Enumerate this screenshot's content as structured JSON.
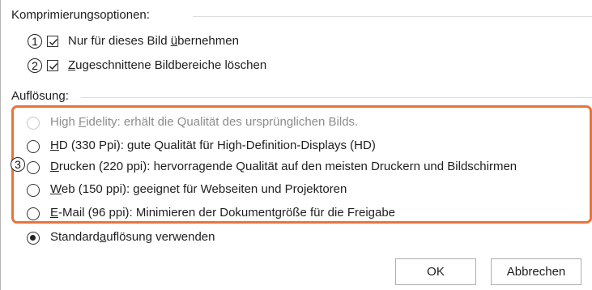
{
  "compression": {
    "title": "Komprimierungsoptionen:",
    "options": [
      {
        "callout": "1",
        "checked": true,
        "pre": "Nur für dieses Bild ",
        "accel": "ü",
        "post": "bernehmen"
      },
      {
        "callout": "2",
        "checked": true,
        "pre": "",
        "accel": "Z",
        "post": "ugeschnittene Bildbereiche löschen"
      }
    ]
  },
  "resolution": {
    "title": "Auflösung:",
    "options": [
      {
        "pre": "High ",
        "accel": "F",
        "post": "idelity: erhält die Qualität des ursprünglichen Bilds.",
        "disabled": true,
        "selected": false
      },
      {
        "pre": "",
        "accel": "H",
        "post": "D (330 Ppi): gute Qualität für High-Definition-Displays (HD)",
        "disabled": false,
        "selected": false
      },
      {
        "pre": "",
        "accel": "D",
        "post": "rucken (220 ppi): hervorragende Qualität auf den meisten Druckern und Bildschirmen",
        "disabled": false,
        "selected": false
      },
      {
        "pre": "",
        "accel": "W",
        "post": "eb (150 ppi): geeignet für Webseiten und Projektoren",
        "disabled": false,
        "selected": false
      },
      {
        "pre": "",
        "accel": "E",
        "post": "-Mail (96 ppi): Minimieren der Dokumentgröße für die Freigabe",
        "disabled": false,
        "selected": false
      }
    ],
    "callout": "3",
    "default_option": {
      "pre": "Standard",
      "accel": "a",
      "post": "uflösung verwenden",
      "selected": true
    }
  },
  "colors": {
    "highlight": "#e8743a"
  },
  "buttons": {
    "ok": "OK",
    "cancel": "Abbrechen"
  }
}
